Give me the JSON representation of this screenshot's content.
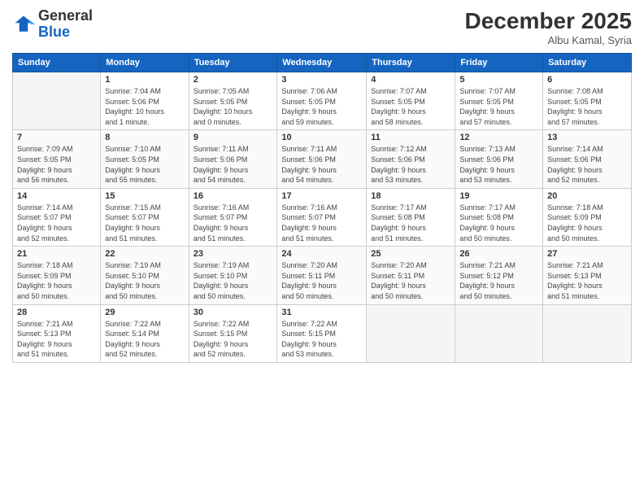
{
  "logo": {
    "general": "General",
    "blue": "Blue"
  },
  "header": {
    "month": "December 2025",
    "location": "Albu Kamal, Syria"
  },
  "days_of_week": [
    "Sunday",
    "Monday",
    "Tuesday",
    "Wednesday",
    "Thursday",
    "Friday",
    "Saturday"
  ],
  "weeks": [
    [
      {
        "day": "",
        "info": ""
      },
      {
        "day": "1",
        "info": "Sunrise: 7:04 AM\nSunset: 5:06 PM\nDaylight: 10 hours\nand 1 minute."
      },
      {
        "day": "2",
        "info": "Sunrise: 7:05 AM\nSunset: 5:05 PM\nDaylight: 10 hours\nand 0 minutes."
      },
      {
        "day": "3",
        "info": "Sunrise: 7:06 AM\nSunset: 5:05 PM\nDaylight: 9 hours\nand 59 minutes."
      },
      {
        "day": "4",
        "info": "Sunrise: 7:07 AM\nSunset: 5:05 PM\nDaylight: 9 hours\nand 58 minutes."
      },
      {
        "day": "5",
        "info": "Sunrise: 7:07 AM\nSunset: 5:05 PM\nDaylight: 9 hours\nand 57 minutes."
      },
      {
        "day": "6",
        "info": "Sunrise: 7:08 AM\nSunset: 5:05 PM\nDaylight: 9 hours\nand 57 minutes."
      }
    ],
    [
      {
        "day": "7",
        "info": "Sunrise: 7:09 AM\nSunset: 5:05 PM\nDaylight: 9 hours\nand 56 minutes."
      },
      {
        "day": "8",
        "info": "Sunrise: 7:10 AM\nSunset: 5:05 PM\nDaylight: 9 hours\nand 55 minutes."
      },
      {
        "day": "9",
        "info": "Sunrise: 7:11 AM\nSunset: 5:06 PM\nDaylight: 9 hours\nand 54 minutes."
      },
      {
        "day": "10",
        "info": "Sunrise: 7:11 AM\nSunset: 5:06 PM\nDaylight: 9 hours\nand 54 minutes."
      },
      {
        "day": "11",
        "info": "Sunrise: 7:12 AM\nSunset: 5:06 PM\nDaylight: 9 hours\nand 53 minutes."
      },
      {
        "day": "12",
        "info": "Sunrise: 7:13 AM\nSunset: 5:06 PM\nDaylight: 9 hours\nand 53 minutes."
      },
      {
        "day": "13",
        "info": "Sunrise: 7:14 AM\nSunset: 5:06 PM\nDaylight: 9 hours\nand 52 minutes."
      }
    ],
    [
      {
        "day": "14",
        "info": "Sunrise: 7:14 AM\nSunset: 5:07 PM\nDaylight: 9 hours\nand 52 minutes."
      },
      {
        "day": "15",
        "info": "Sunrise: 7:15 AM\nSunset: 5:07 PM\nDaylight: 9 hours\nand 51 minutes."
      },
      {
        "day": "16",
        "info": "Sunrise: 7:16 AM\nSunset: 5:07 PM\nDaylight: 9 hours\nand 51 minutes."
      },
      {
        "day": "17",
        "info": "Sunrise: 7:16 AM\nSunset: 5:07 PM\nDaylight: 9 hours\nand 51 minutes."
      },
      {
        "day": "18",
        "info": "Sunrise: 7:17 AM\nSunset: 5:08 PM\nDaylight: 9 hours\nand 51 minutes."
      },
      {
        "day": "19",
        "info": "Sunrise: 7:17 AM\nSunset: 5:08 PM\nDaylight: 9 hours\nand 50 minutes."
      },
      {
        "day": "20",
        "info": "Sunrise: 7:18 AM\nSunset: 5:09 PM\nDaylight: 9 hours\nand 50 minutes."
      }
    ],
    [
      {
        "day": "21",
        "info": "Sunrise: 7:18 AM\nSunset: 5:09 PM\nDaylight: 9 hours\nand 50 minutes."
      },
      {
        "day": "22",
        "info": "Sunrise: 7:19 AM\nSunset: 5:10 PM\nDaylight: 9 hours\nand 50 minutes."
      },
      {
        "day": "23",
        "info": "Sunrise: 7:19 AM\nSunset: 5:10 PM\nDaylight: 9 hours\nand 50 minutes."
      },
      {
        "day": "24",
        "info": "Sunrise: 7:20 AM\nSunset: 5:11 PM\nDaylight: 9 hours\nand 50 minutes."
      },
      {
        "day": "25",
        "info": "Sunrise: 7:20 AM\nSunset: 5:11 PM\nDaylight: 9 hours\nand 50 minutes."
      },
      {
        "day": "26",
        "info": "Sunrise: 7:21 AM\nSunset: 5:12 PM\nDaylight: 9 hours\nand 50 minutes."
      },
      {
        "day": "27",
        "info": "Sunrise: 7:21 AM\nSunset: 5:13 PM\nDaylight: 9 hours\nand 51 minutes."
      }
    ],
    [
      {
        "day": "28",
        "info": "Sunrise: 7:21 AM\nSunset: 5:13 PM\nDaylight: 9 hours\nand 51 minutes."
      },
      {
        "day": "29",
        "info": "Sunrise: 7:22 AM\nSunset: 5:14 PM\nDaylight: 9 hours\nand 52 minutes."
      },
      {
        "day": "30",
        "info": "Sunrise: 7:22 AM\nSunset: 5:15 PM\nDaylight: 9 hours\nand 52 minutes."
      },
      {
        "day": "31",
        "info": "Sunrise: 7:22 AM\nSunset: 5:15 PM\nDaylight: 9 hours\nand 53 minutes."
      },
      {
        "day": "",
        "info": ""
      },
      {
        "day": "",
        "info": ""
      },
      {
        "day": "",
        "info": ""
      }
    ]
  ]
}
